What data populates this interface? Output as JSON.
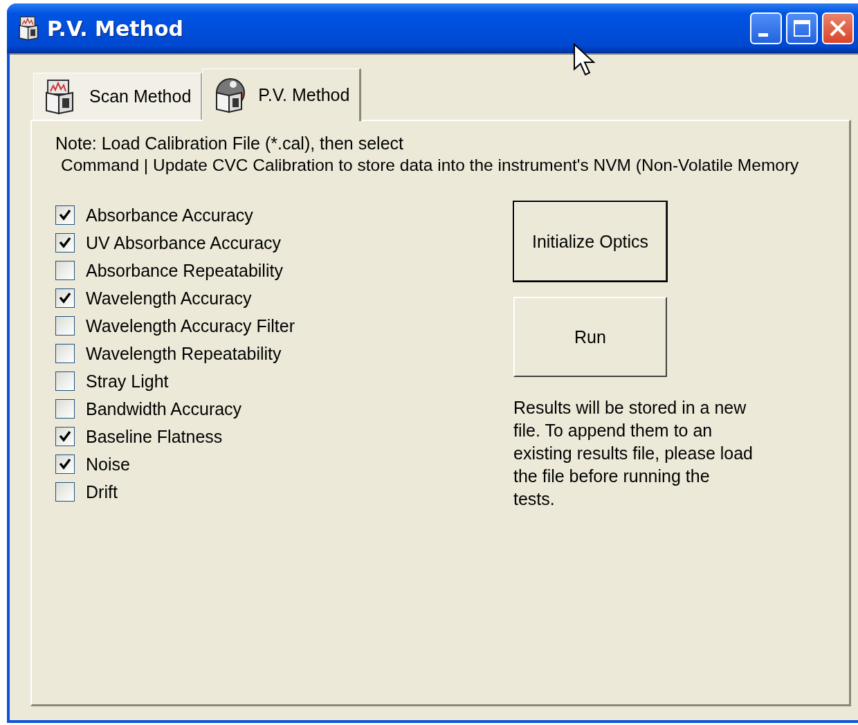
{
  "window": {
    "title": "P.V. Method"
  },
  "tabs": [
    {
      "label": "Scan Method",
      "kind": "scan",
      "selected": false
    },
    {
      "label": "P.V. Method",
      "kind": "pv",
      "selected": true
    }
  ],
  "note": [
    "Note: Load Calibration File (*.cal), then select",
    "Command | Update CVC Calibration to store data into the instrument's NVM (Non-Volatile Memory"
  ],
  "tests": [
    {
      "label": "Absorbance Accuracy",
      "checked": true
    },
    {
      "label": "UV Absorbance Accuracy",
      "checked": true
    },
    {
      "label": "Absorbance Repeatability",
      "checked": false
    },
    {
      "label": "Wavelength Accuracy",
      "checked": true
    },
    {
      "label": "Wavelength Accuracy Filter",
      "checked": false
    },
    {
      "label": "Wavelength Repeatability",
      "checked": false
    },
    {
      "label": "Stray Light",
      "checked": false
    },
    {
      "label": "Bandwidth Accuracy",
      "checked": false
    },
    {
      "label": "Baseline Flatness",
      "checked": true
    },
    {
      "label": "Noise",
      "checked": true
    },
    {
      "label": "Drift",
      "checked": false
    }
  ],
  "buttons": [
    {
      "label": "Initialize Optics",
      "kind": "default"
    },
    {
      "label": "Run",
      "kind": "normal"
    }
  ],
  "results_note": "Results will be stored in a new file.  To append them to an existing results file, please load the file before running the tests."
}
